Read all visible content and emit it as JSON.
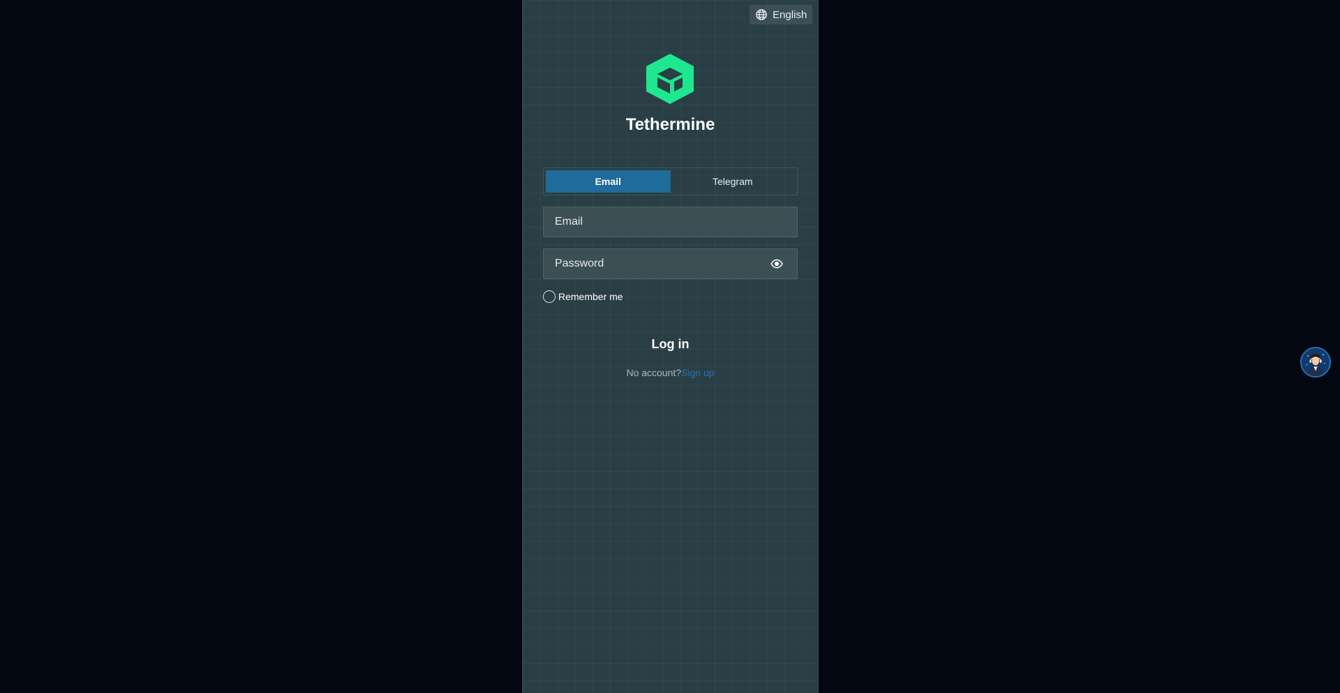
{
  "header": {
    "language_label": "English",
    "language_icon": "globe-icon"
  },
  "brand": {
    "name": "Tethermine",
    "logo_icon": "cube-logo-icon",
    "logo_color": "#1de88e"
  },
  "login_tabs": [
    {
      "label": "Email",
      "active": true
    },
    {
      "label": "Telegram",
      "active": false
    }
  ],
  "form": {
    "email_placeholder": "Email",
    "email_value": "",
    "password_placeholder": "Password",
    "password_value": "",
    "password_toggle_icon": "eye-icon",
    "remember_label": "Remember me",
    "remember_checked": false,
    "login_label": "Log in"
  },
  "footer": {
    "no_account_text": "No account?",
    "signup_label": "Sign up"
  },
  "support": {
    "icon": "support-agent-avatar"
  },
  "colors": {
    "background": "#030711",
    "panel": "#2a3e45",
    "accent": "#1f6b99",
    "link": "#1f78b4",
    "logo": "#1de88e"
  }
}
